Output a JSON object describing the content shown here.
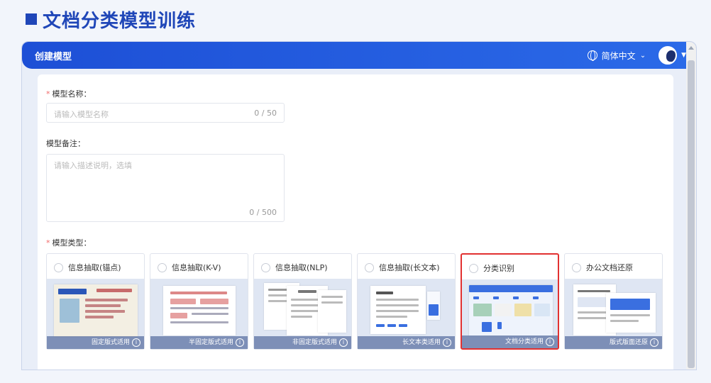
{
  "slide": {
    "title": "文档分类模型训练"
  },
  "header": {
    "title": "创建模型",
    "language": "简体中文",
    "language_chevron": "⌄",
    "user_caret": "▼"
  },
  "form": {
    "name_label": "模型名称：",
    "name_placeholder": "请输入模型名称",
    "name_counter": "0 / 50",
    "remark_label": "模型备注：",
    "remark_placeholder": "请输入描述说明，选填",
    "remark_counter": "0 / 500",
    "type_label": "模型类型："
  },
  "model_types": [
    {
      "name": "信息抽取(锚点)",
      "caption": "固定版式适用",
      "selected": false
    },
    {
      "name": "信息抽取(K-V)",
      "caption": "半固定版式适用",
      "selected": false
    },
    {
      "name": "信息抽取(NLP)",
      "caption": "非固定版式适用",
      "selected": false
    },
    {
      "name": "信息抽取(长文本)",
      "caption": "长文本类适用",
      "selected": false
    },
    {
      "name": "分类识别",
      "caption": "文档分类适用",
      "selected": true
    },
    {
      "name": "办公文档还原",
      "caption": "版式版面还原",
      "selected": false
    }
  ],
  "info_glyph": "i",
  "colors": {
    "accent": "#1f46b8",
    "header": "#1d4fd6",
    "selected_border": "#e23131",
    "required": "#f26a6a"
  }
}
